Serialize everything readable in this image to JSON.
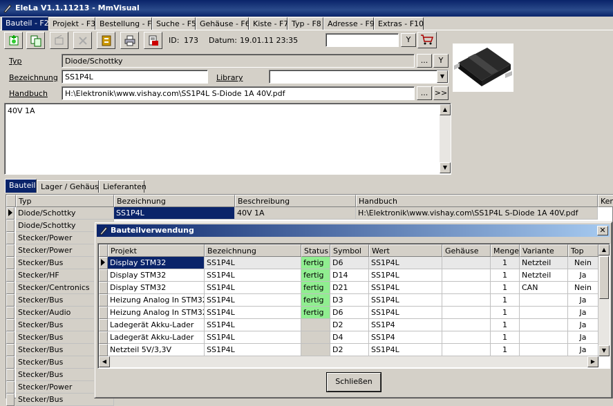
{
  "window": {
    "title": "EleLa V1.1.11213 - MmVisual"
  },
  "tabs": [
    {
      "label": "Bauteil - F2"
    },
    {
      "label": "Projekt - F3"
    },
    {
      "label": "Bestellung - F4"
    },
    {
      "label": "Suche - F5"
    },
    {
      "label": "Gehäuse - F6"
    },
    {
      "label": "Kiste - F7"
    },
    {
      "label": "Typ - F8"
    },
    {
      "label": "Adresse - F9"
    },
    {
      "label": "Extras - F10"
    }
  ],
  "toolbar": {
    "id_label": "ID:",
    "id_value": "173",
    "datum_label": "Datum:",
    "datum_value": "19.01.11 23:35",
    "filter_button": "Y"
  },
  "form": {
    "typ_label": "Typ",
    "typ_value": "Diode/Schottky",
    "typ_browse": "...",
    "typ_filter": "Y",
    "bezeichnung_label": "Bezeichnung",
    "bezeichnung_value": "SS1P4L",
    "library_label": "Library",
    "library_value": "",
    "handbuch_label": "Handbuch",
    "handbuch_value": "H:\\Elektronik\\www.vishay.com\\SS1P4L S-Diode 1A 40V.pdf",
    "handbuch_browse": "...",
    "handbuch_open": ">>",
    "notes": "40V 1A"
  },
  "subtabs": [
    {
      "label": "Bauteil"
    },
    {
      "label": "Lager / Gehäuse"
    },
    {
      "label": "Lieferanten"
    }
  ],
  "main_grid": {
    "columns": [
      "Typ",
      "Bezeichnung",
      "Beschreibung",
      "Handbuch",
      "Kenn"
    ],
    "first_row": {
      "typ": "Diode/Schottky",
      "bezeichnung": "SS1P4L",
      "beschreibung": "40V 1A",
      "handbuch": "H:\\Elektronik\\www.vishay.com\\SS1P4L S-Diode 1A 40V.pdf"
    },
    "typ_rows": [
      "Diode/Schottky",
      "Stecker/Power",
      "Stecker/Power",
      "Stecker/Bus",
      "Stecker/HF",
      "Stecker/Centronics",
      "Stecker/Bus",
      "Stecker/Audio",
      "Stecker/Bus",
      "Stecker/Bus",
      "Stecker/Bus",
      "Stecker/Bus",
      "Stecker/Bus",
      "Stecker/Power",
      "Stecker/Bus"
    ]
  },
  "dialog": {
    "title": "Bauteilverwendung",
    "columns": [
      "Projekt",
      "Bezeichnung",
      "Status",
      "Symbol",
      "Wert",
      "Gehäuse",
      "Menge",
      "Variante",
      "Top"
    ],
    "rows": [
      {
        "projekt": "Display STM32",
        "bezeichnung": "SS1P4L",
        "status": "fertig",
        "symbol": "D6",
        "wert": "SS1P4L",
        "gehaeuse": "",
        "menge": "1",
        "variante": "Netzteil",
        "top": "Nein"
      },
      {
        "projekt": "Display STM32",
        "bezeichnung": "SS1P4L",
        "status": "fertig",
        "symbol": "D14",
        "wert": "SS1P4L",
        "gehaeuse": "",
        "menge": "1",
        "variante": "Netzteil",
        "top": "Ja"
      },
      {
        "projekt": "Display STM32",
        "bezeichnung": "SS1P4L",
        "status": "fertig",
        "symbol": "D21",
        "wert": "SS1P4L",
        "gehaeuse": "",
        "menge": "1",
        "variante": "CAN",
        "top": "Nein"
      },
      {
        "projekt": "Heizung Analog In STM32",
        "bezeichnung": "SS1P4L",
        "status": "fertig",
        "symbol": "D3",
        "wert": "SS1P4L",
        "gehaeuse": "",
        "menge": "1",
        "variante": "",
        "top": "Ja"
      },
      {
        "projekt": "Heizung Analog In STM32",
        "bezeichnung": "SS1P4L",
        "status": "fertig",
        "symbol": "D6",
        "wert": "SS1P4L",
        "gehaeuse": "",
        "menge": "1",
        "variante": "",
        "top": "Ja"
      },
      {
        "projekt": "Ladegerät Akku-Lader",
        "bezeichnung": "SS1P4L",
        "status": "",
        "symbol": "D2",
        "wert": "SS1P4",
        "gehaeuse": "",
        "menge": "1",
        "variante": "",
        "top": "Ja"
      },
      {
        "projekt": "Ladegerät Akku-Lader",
        "bezeichnung": "SS1P4L",
        "status": "",
        "symbol": "D4",
        "wert": "SS1P4",
        "gehaeuse": "",
        "menge": "1",
        "variante": "",
        "top": "Ja"
      },
      {
        "projekt": "Netzteil 5V/3,3V",
        "bezeichnung": "SS1P4L",
        "status": "",
        "symbol": "D2",
        "wert": "SS1P4L",
        "gehaeuse": "",
        "menge": "1",
        "variante": "",
        "top": "Ja"
      }
    ],
    "close_button": "Schließen"
  },
  "colors": {
    "title_blue": "#0a246a",
    "selection": "#0a246a",
    "status_green": "#90ee90",
    "face": "#d4d0c8"
  }
}
